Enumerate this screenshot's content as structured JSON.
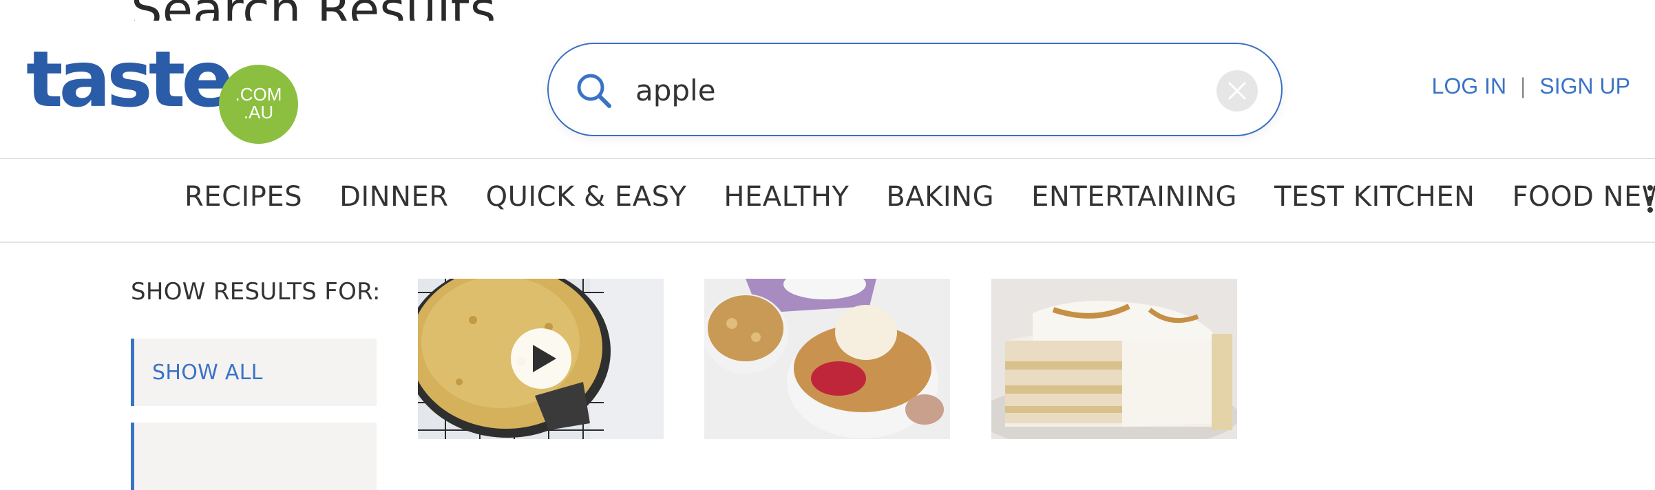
{
  "page": {
    "ghost_title": "Search Results"
  },
  "logo": {
    "wordmark": "taste",
    "badge_top": ".COM",
    "badge_bottom": ".AU"
  },
  "search": {
    "value": "apple",
    "placeholder": ""
  },
  "auth": {
    "login_label": "LOG IN",
    "separator": "|",
    "signup_label": "SIGN UP"
  },
  "nav": {
    "items": [
      {
        "label": "RECIPES"
      },
      {
        "label": "DINNER"
      },
      {
        "label": "QUICK & EASY"
      },
      {
        "label": "HEALTHY"
      },
      {
        "label": "BAKING"
      },
      {
        "label": "ENTERTAINING"
      },
      {
        "label": "TEST KITCHEN"
      },
      {
        "label": "FOOD NEWS"
      }
    ]
  },
  "filters": {
    "heading": "SHOW RESULTS FOR:",
    "items": [
      {
        "label": "SHOW ALL"
      },
      {
        "label": ""
      }
    ]
  },
  "results": [
    {
      "image": "apple-pie-on-cooling-rack",
      "has_video": true
    },
    {
      "image": "apple-crumble-with-ice-cream",
      "has_video": false
    },
    {
      "image": "apple-charlotte-cake",
      "has_video": false
    }
  ],
  "colors": {
    "brand_blue": "#2b5ca8",
    "link_blue": "#3a73c6",
    "badge_green": "#8cbf3f",
    "filter_bg": "#f4f3f1"
  }
}
